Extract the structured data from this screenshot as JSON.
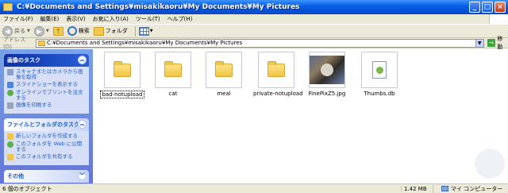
{
  "window": {
    "title": "C:¥Documents and Settings¥misakikaoru¥My Documents¥My Pictures"
  },
  "menu": [
    "ファイル(F)",
    "編集(E)",
    "表示(V)",
    "お気に入り(A)",
    "ツール(T)",
    "ヘルプ(H)"
  ],
  "toolbar": {
    "back_label": "戻る",
    "search_label": "検索",
    "folders_label": "フォルダ"
  },
  "address": {
    "label": "アドレス(D)",
    "path": "C:¥Documents and Settings¥misakikaoru¥My Documents¥My Pictures",
    "go_label": "移動"
  },
  "tasks": {
    "picture_panel": {
      "title": "画像のタスク",
      "items": [
        "スキャナまたはカメラから画像を取得",
        "スライドショーを表示する",
        "オンラインでプリントを注文する",
        "画像を印刷する"
      ]
    },
    "file_panel": {
      "title": "ファイルとフォルダのタスク",
      "items": [
        "新しいフォルダを作成する",
        "このフォルダを Web に公開する",
        "このフォルダを共有する"
      ]
    },
    "other_panel": {
      "title": "その他"
    }
  },
  "files": [
    {
      "name": "bad-notupload",
      "type": "folder",
      "selected": true
    },
    {
      "name": "cat",
      "type": "folder"
    },
    {
      "name": "meal",
      "type": "folder"
    },
    {
      "name": "private-notupload",
      "type": "folder"
    },
    {
      "name": "FinePixZ5.jpg",
      "type": "image"
    },
    {
      "name": "Thumbs.db",
      "type": "db"
    }
  ],
  "status": {
    "objects": "6 個のオブジェクト",
    "size": "1.42 MB",
    "zone": "マイ コンピューター"
  }
}
